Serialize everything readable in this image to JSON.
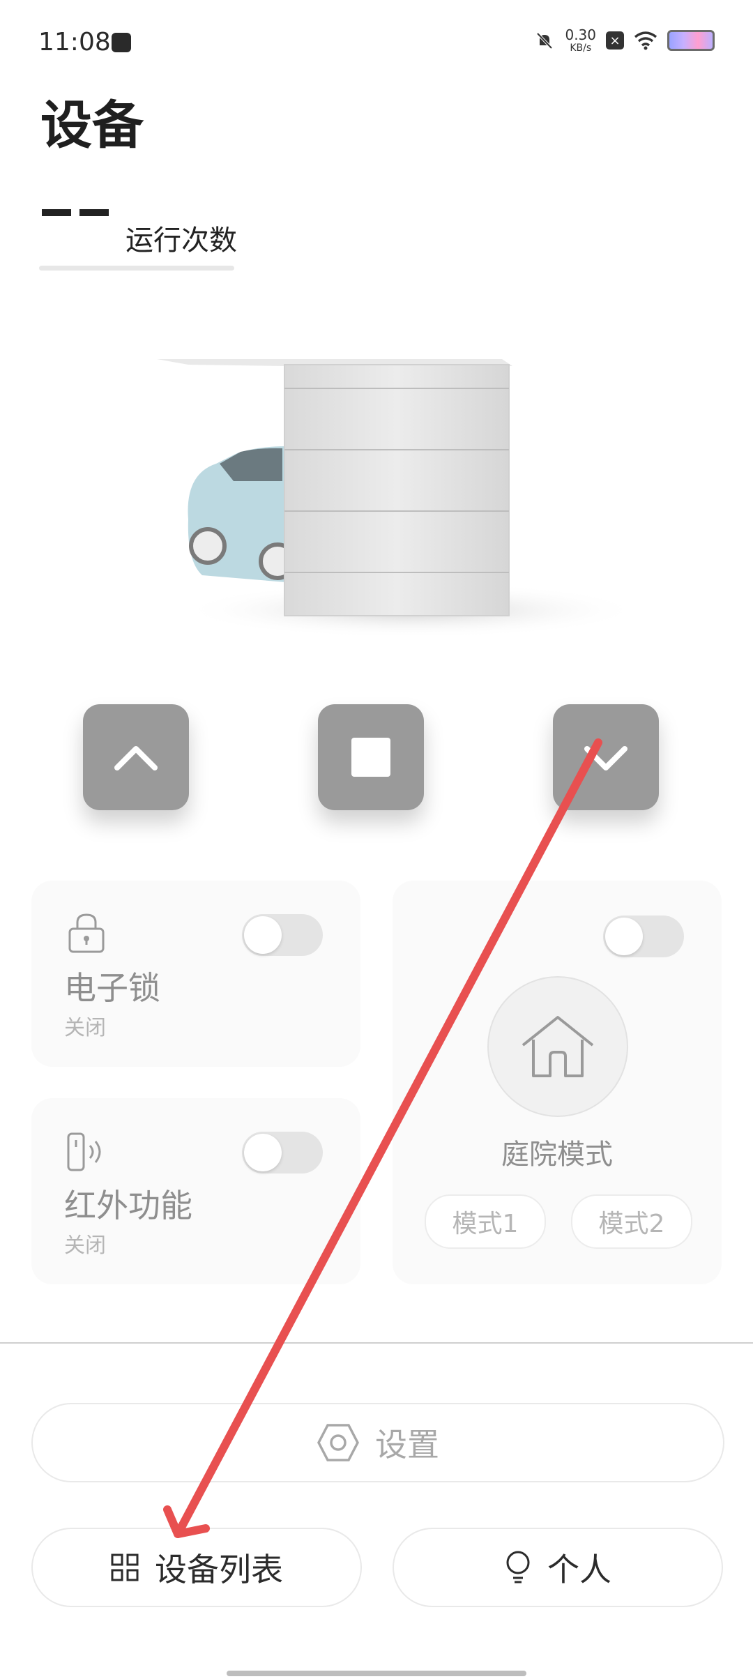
{
  "status_bar": {
    "time": "11:08",
    "speed_value": "0.30",
    "speed_unit": "KB/s",
    "icons": [
      "app-notification-icon",
      "mute-bell-icon",
      "x-badge-icon",
      "wifi-icon",
      "battery-icon"
    ]
  },
  "header": {
    "title": "设备"
  },
  "run_count": {
    "value": "--",
    "label": "运行次数"
  },
  "controls": {
    "up_icon": "chevron-up-icon",
    "stop_icon": "stop-square-icon",
    "down_icon": "chevron-down-icon"
  },
  "cards": {
    "lock": {
      "title": "电子锁",
      "status": "关闭",
      "icon": "lock-icon",
      "toggle_on": false
    },
    "infrared": {
      "title": "红外功能",
      "status": "关闭",
      "icon": "infrared-icon",
      "toggle_on": false
    },
    "yard": {
      "title": "庭院模式",
      "icon": "home-icon",
      "toggle_on": false,
      "mode1": "模式1",
      "mode2": "模式2"
    }
  },
  "bottom": {
    "settings_label": "设置",
    "device_list_label": "设备列表",
    "personal_label": "个人"
  },
  "colors": {
    "control_button": "#9a9a9a",
    "card_bg": "#fafafa",
    "annotation_arrow": "#e85050"
  }
}
